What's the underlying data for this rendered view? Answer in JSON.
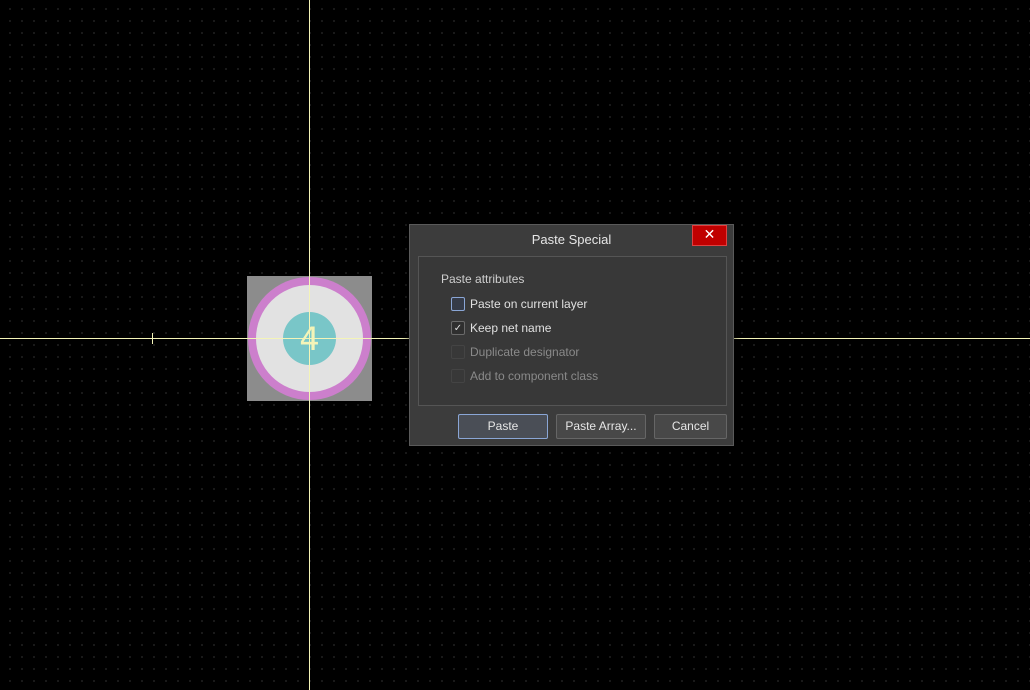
{
  "canvas": {
    "pad": {
      "number": "4"
    },
    "colors": {
      "background": "#000000",
      "crosshair": "#f4f4b8",
      "pad_outer": "#cc7fcc",
      "pad_hole": "#79c6c8",
      "pad_square": "#8c8c8c"
    }
  },
  "dialog": {
    "title": "Paste Special",
    "close_label": "✕",
    "group_label": "Paste attributes",
    "options": [
      {
        "label": "Paste on current layer",
        "checked": false,
        "enabled": true
      },
      {
        "label": "Keep net name",
        "checked": true,
        "enabled": true
      },
      {
        "label": "Duplicate designator",
        "checked": false,
        "enabled": false
      },
      {
        "label": "Add to component class",
        "checked": false,
        "enabled": false
      }
    ],
    "buttons": {
      "paste": "Paste",
      "paste_array": "Paste Array...",
      "cancel": "Cancel"
    }
  }
}
